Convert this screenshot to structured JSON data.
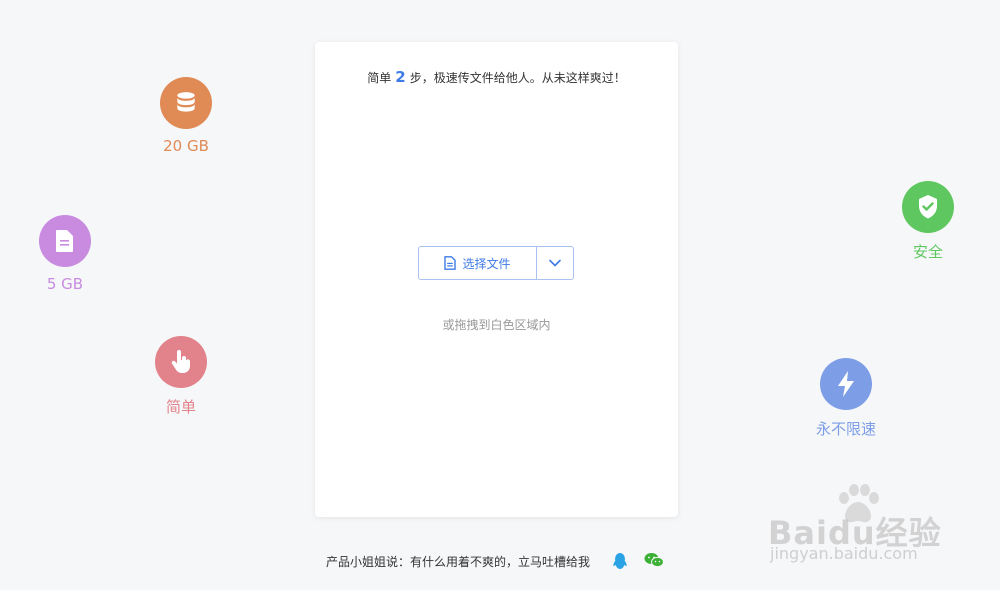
{
  "features": {
    "storage_20": {
      "label": "20 GB",
      "icon": "database-icon"
    },
    "storage_5": {
      "label": "5 GB",
      "icon": "document-icon"
    },
    "simple": {
      "label": "简单",
      "icon": "hand-pointer-icon"
    },
    "secure": {
      "label": "安全",
      "icon": "shield-check-icon"
    },
    "speed": {
      "label": "永不限速",
      "icon": "lightning-icon"
    }
  },
  "card": {
    "headline_prefix": "简单",
    "headline_number": "2",
    "headline_suffix": "步，极速传文件给他人。从未这样爽过！",
    "select_button_label": "选择文件",
    "hint": "或拖拽到白色区域内"
  },
  "footer": {
    "text": "产品小姐姐说：有什么用着不爽的，立马吐槽给我"
  },
  "watermark": {
    "brand": "Baidu经验",
    "url": "jingyan.baidu.com"
  },
  "colors": {
    "accent": "#3f7be6",
    "storage_20": "#e08a55",
    "storage_5": "#c88be0",
    "simple": "#e2838b",
    "secure": "#5fc75f",
    "speed": "#7d9ee6"
  }
}
